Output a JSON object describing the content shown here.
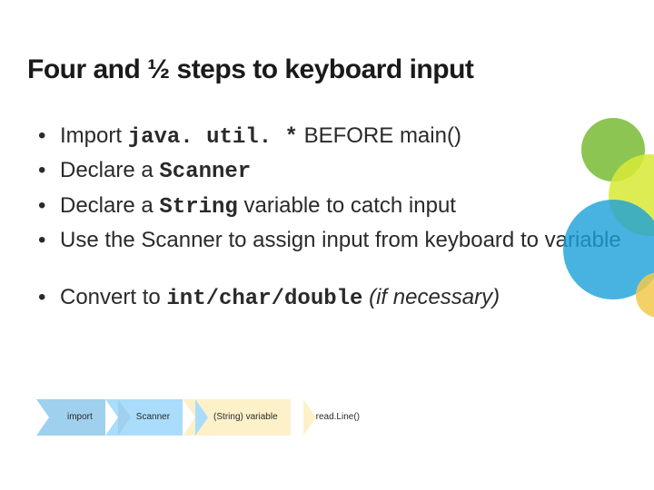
{
  "title": "Four and ½  steps to keyboard input",
  "bullets": [
    {
      "pre": "Import ",
      "code": "java. util. *",
      "post": " BEFORE main()"
    },
    {
      "pre": "Declare a ",
      "code": "Scanner",
      "post": ""
    },
    {
      "pre": "Declare a ",
      "code": "String",
      "post": " variable to catch input"
    },
    {
      "pre": "Use the Scanner to assign input from keyboard to variable",
      "code": "",
      "post": ""
    }
  ],
  "extra": {
    "pre": "Convert to ",
    "code": "int/char/double",
    "post_italic": " (if necessary)"
  },
  "steps": [
    "import",
    "Scanner",
    "(String) variable",
    "read.Line()"
  ]
}
